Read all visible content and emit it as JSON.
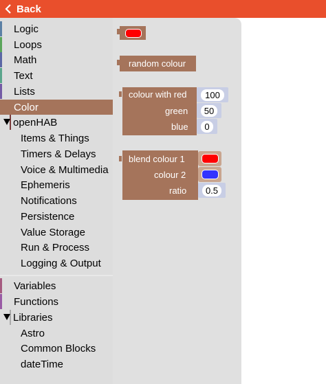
{
  "header": {
    "back_label": "Back",
    "color": "#e94f2c"
  },
  "sidebar": {
    "categories": [
      {
        "label": "Logic",
        "color": "#5b80a5"
      },
      {
        "label": "Loops",
        "color": "#5ba55b"
      },
      {
        "label": "Math",
        "color": "#5b67a5"
      },
      {
        "label": "Text",
        "color": "#5ba58c"
      },
      {
        "label": "Lists",
        "color": "#745ba5"
      },
      {
        "label": "Color",
        "color": "#a5745b",
        "selected": true
      },
      {
        "label": "openHAB",
        "color": "#7a3b3b"
      }
    ],
    "openhab_items": [
      "Items & Things",
      "Timers & Delays",
      "Voice & Multimedia",
      "Ephemeris",
      "Notifications",
      "Persistence",
      "Value Storage",
      "Run & Process",
      "Logging & Output"
    ],
    "bottom_categories": [
      {
        "label": "Variables",
        "color": "#a55b80"
      },
      {
        "label": "Functions",
        "color": "#995ba5"
      },
      {
        "label": "Libraries",
        "color": "#aaaaaa"
      }
    ],
    "library_items": [
      "Astro",
      "Common Blocks",
      "dateTime"
    ]
  },
  "flyout": {
    "block_color": "#a5745b",
    "picker_block": {
      "colour": "#ff0000"
    },
    "random_block": {
      "label": "random colour"
    },
    "rgb_block": {
      "label": "colour with red",
      "red": "100",
      "green_label": "green",
      "green": "50",
      "blue_label": "blue",
      "blue": "0"
    },
    "blend_block": {
      "label": "blend colour 1",
      "colour1": "#ff0000",
      "colour2_label": "colour 2",
      "colour2": "#3333ff",
      "ratio_label": "ratio",
      "ratio": "0.5"
    }
  }
}
